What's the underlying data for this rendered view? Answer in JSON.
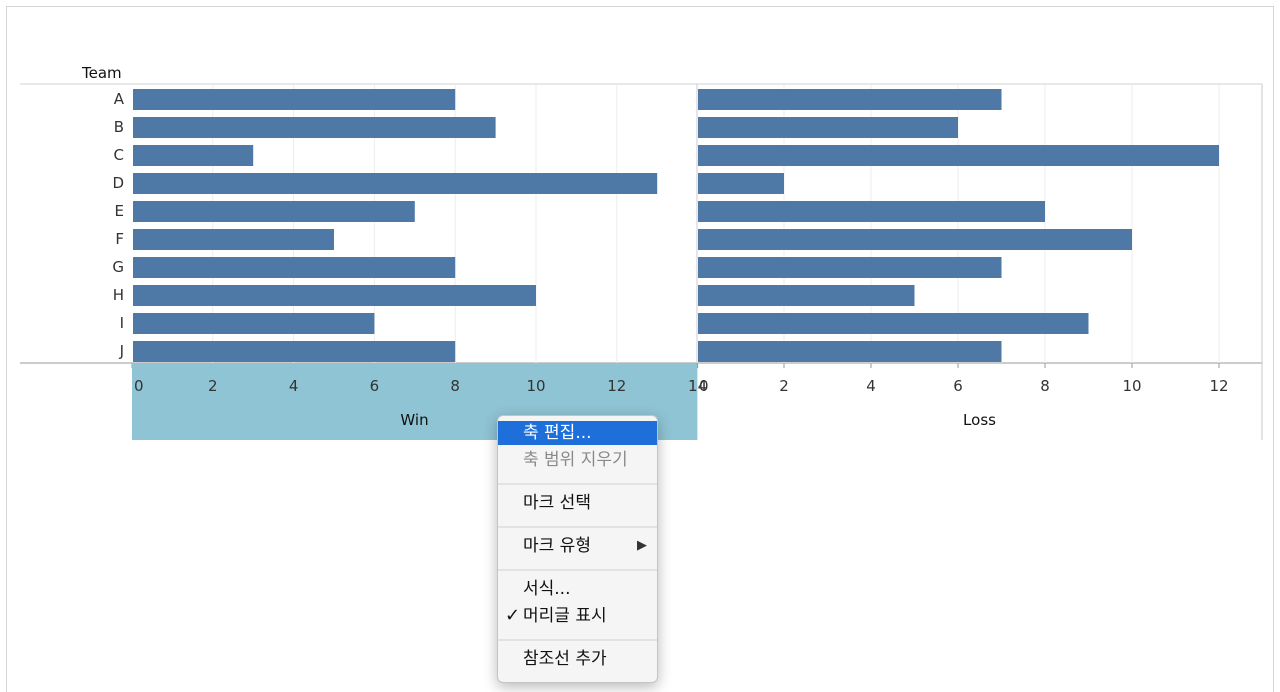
{
  "window": {
    "title": ""
  },
  "header": {
    "rows_label": "Team"
  },
  "chart_data": [
    {
      "type": "bar",
      "orientation": "horizontal",
      "categories": [
        "A",
        "B",
        "C",
        "D",
        "E",
        "F",
        "G",
        "H",
        "I",
        "J"
      ],
      "values": [
        8,
        9,
        3,
        13,
        7,
        5,
        8,
        10,
        6,
        8
      ],
      "xlabel": "Win",
      "xlim": [
        0,
        14
      ],
      "ticks": [
        "0",
        "2",
        "4",
        "6",
        "8",
        "10",
        "12",
        "14"
      ],
      "grid": true,
      "bar_color": "#4e79a7",
      "axis_highlight_color": "#8fc4d4"
    },
    {
      "type": "bar",
      "orientation": "horizontal",
      "categories": [
        "A",
        "B",
        "C",
        "D",
        "E",
        "F",
        "G",
        "H",
        "I",
        "J"
      ],
      "values": [
        7,
        6,
        12,
        2,
        8,
        10,
        7,
        5,
        9,
        7
      ],
      "xlabel": "Loss",
      "xlim": [
        0,
        12.5
      ],
      "ticks": [
        "0",
        "2",
        "4",
        "6",
        "8",
        "10",
        "12"
      ],
      "grid": true,
      "bar_color": "#4e79a7"
    }
  ],
  "context_menu": {
    "items": [
      {
        "label": "축 편집...",
        "state": "highlighted"
      },
      {
        "label": "축 범위 지우기",
        "state": "disabled"
      },
      {
        "label": "마크 선택",
        "state": "normal"
      },
      {
        "label": "마크 유형",
        "state": "normal",
        "submenu_icon": "▶"
      },
      {
        "label": "서식...",
        "state": "normal"
      },
      {
        "label": "머리글 표시",
        "state": "checked",
        "check_icon": "✓"
      },
      {
        "label": "참조선 추가",
        "state": "normal"
      }
    ]
  }
}
